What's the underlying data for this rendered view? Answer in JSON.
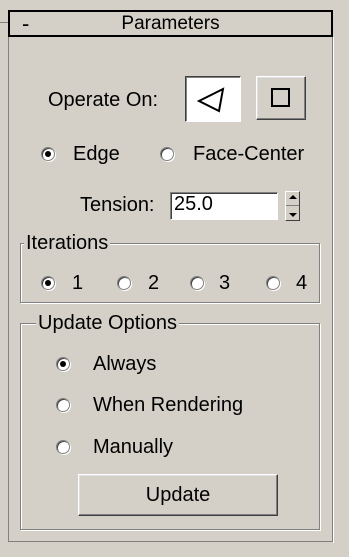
{
  "rollout": {
    "collapse_symbol": "-",
    "title": "Parameters"
  },
  "operate_on": {
    "label": "Operate On:",
    "buttons": [
      {
        "name": "polygon-mode",
        "icon": "triangle-outline-icon",
        "pressed": true
      },
      {
        "name": "quad-mode",
        "icon": "square-outline-icon",
        "pressed": false
      }
    ]
  },
  "mode": {
    "options": [
      {
        "label": "Edge",
        "selected": true
      },
      {
        "label": "Face-Center",
        "selected": false
      }
    ]
  },
  "tension": {
    "label": "Tension:",
    "value": "25.0"
  },
  "iterations": {
    "title": "Iterations",
    "options": [
      {
        "label": "1",
        "selected": true
      },
      {
        "label": "2",
        "selected": false
      },
      {
        "label": "3",
        "selected": false
      },
      {
        "label": "4",
        "selected": false
      }
    ]
  },
  "update_options": {
    "title": "Update Options",
    "options": [
      {
        "label": "Always",
        "selected": true
      },
      {
        "label": "When Rendering",
        "selected": false
      },
      {
        "label": "Manually",
        "selected": false
      }
    ],
    "button_label": "Update"
  }
}
